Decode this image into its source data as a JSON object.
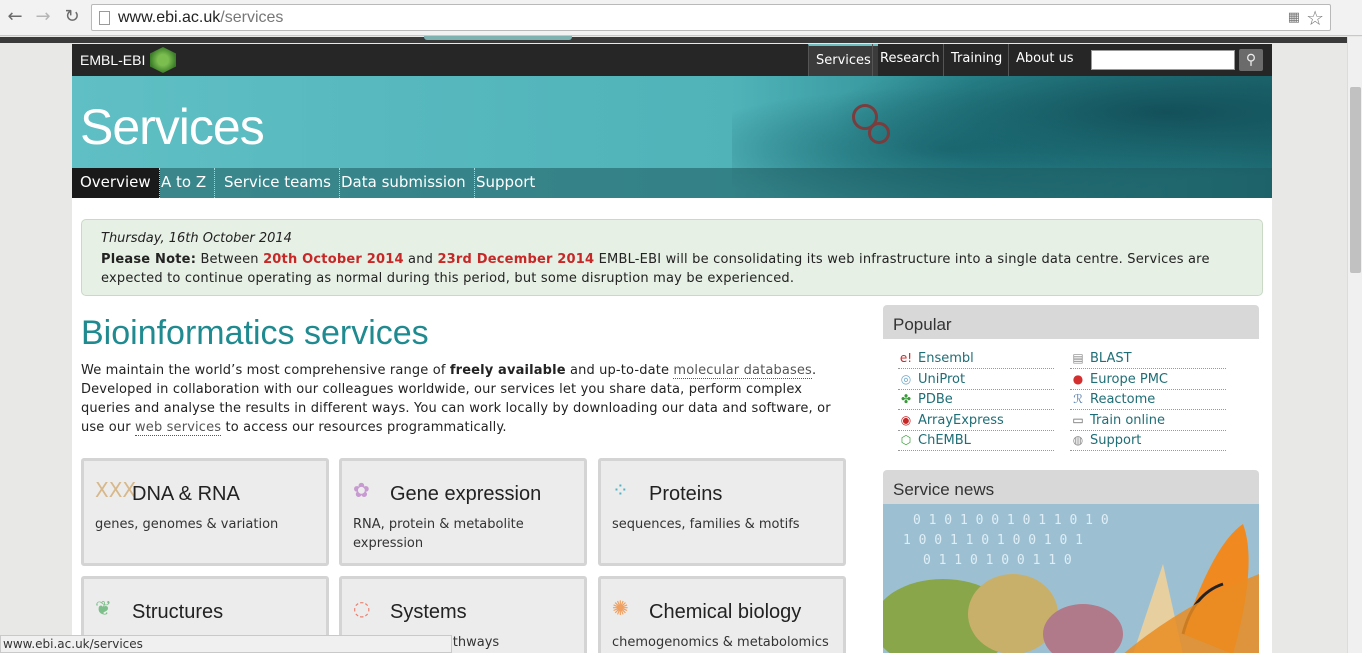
{
  "browser": {
    "url_host": "www.ebi.ac.uk",
    "url_path": "/services",
    "status_url": "www.ebi.ac.uk/services"
  },
  "topbar": {
    "logo": "EMBL-EBI",
    "nav": [
      "Services",
      "Research",
      "Training",
      "About us"
    ],
    "search_placeholder": ""
  },
  "masthead": {
    "title": "Services",
    "subnav": [
      "Overview",
      "A to Z",
      "Service teams",
      "Data submission",
      "Support"
    ]
  },
  "notice": {
    "date": "Thursday, 16th October 2014",
    "please_note": "Please Note:",
    "between": " Between ",
    "date1": "20th October 2014",
    "and": " and ",
    "date2": "23rd December 2014",
    "rest": " EMBL-EBI will be consolidating its web infrastructure into a single data centre. Services are expected to continue operating as normal during this period, but some disruption may be experienced."
  },
  "main": {
    "heading": "Bioinformatics services",
    "intro_1": "We maintain the world’s most comprehensive range of ",
    "intro_bold": "freely available",
    "intro_2": " and up-to-date ",
    "intro_link1": "molecular databases",
    "intro_3": ". Developed in collaboration with our colleagues worldwide, our services let you share data, perform complex queries and analyse the results in different ways. You can work locally by downloading our data and software, or use our ",
    "intro_link2": "web services",
    "intro_4": " to access our resources programmatically."
  },
  "cards": [
    {
      "title": "DNA & RNA",
      "desc": "genes, genomes & variation",
      "icon": "dna-icon",
      "glyph": "XXX",
      "color": "#d7b88a"
    },
    {
      "title": "Gene expression",
      "desc": "RNA, protein & metabolite expression",
      "icon": "gene-expression-icon",
      "glyph": "✿",
      "color": "#c79ad1"
    },
    {
      "title": "Proteins",
      "desc": "sequences, families & motifs",
      "icon": "proteins-icon",
      "glyph": "⁘",
      "color": "#4fb3c6"
    },
    {
      "title": "Structures",
      "desc": "",
      "icon": "structures-icon",
      "glyph": "❦",
      "color": "#7cbf8a"
    },
    {
      "title": "Systems",
      "desc": "…ractions & pathways",
      "icon": "systems-icon",
      "glyph": "◌",
      "color": "#e8806f"
    },
    {
      "title": "Chemical biology",
      "desc": "chemogenomics & metabolomics",
      "icon": "chemical-biology-icon",
      "glyph": "✺",
      "color": "#f0a060"
    }
  ],
  "popular": {
    "heading": "Popular",
    "left": [
      {
        "label": "Ensembl",
        "icon": "ensembl-icon",
        "glyph": "e!",
        "color": "#c62828"
      },
      {
        "label": "UniProt",
        "icon": "uniprot-icon",
        "glyph": "◎",
        "color": "#6aa6c9"
      },
      {
        "label": "PDBe",
        "icon": "pdbe-icon",
        "glyph": "✤",
        "color": "#3a9a3a"
      },
      {
        "label": "ArrayExpress",
        "icon": "arrayexpress-icon",
        "glyph": "◉",
        "color": "#c62828"
      },
      {
        "label": "ChEMBL",
        "icon": "chembl-icon",
        "glyph": "⬡",
        "color": "#3a9a3a"
      }
    ],
    "right": [
      {
        "label": "BLAST",
        "icon": "blast-icon",
        "glyph": "▤",
        "color": "#888888"
      },
      {
        "label": "Europe PMC",
        "icon": "europe-pmc-icon",
        "glyph": "●",
        "color": "#d32f2f"
      },
      {
        "label": "Reactome",
        "icon": "reactome-icon",
        "glyph": "ℛ",
        "color": "#5a7fb0"
      },
      {
        "label": "Train online",
        "icon": "train-online-icon",
        "glyph": "▭",
        "color": "#666666"
      },
      {
        "label": "Support",
        "icon": "support-icon",
        "glyph": "◍",
        "color": "#888888"
      }
    ]
  },
  "news": {
    "heading": "Service news"
  }
}
